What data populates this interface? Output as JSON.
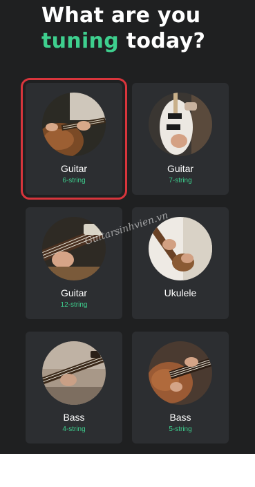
{
  "header": {
    "line1": "What are you",
    "accent": "tuning",
    "rest": "today?"
  },
  "instruments": [
    {
      "name": "Guitar",
      "sub": "6-string",
      "icon": "acoustic-guitar-photo",
      "selected": true
    },
    {
      "name": "Guitar",
      "sub": "7-string",
      "icon": "electric-guitar-photo"
    },
    {
      "name": "Guitar",
      "sub": "12-string",
      "icon": "twelve-string-guitar-photo"
    },
    {
      "name": "Ukulele",
      "sub": "",
      "icon": "ukulele-photo"
    },
    {
      "name": "Bass",
      "sub": "4-string",
      "icon": "bass-4-photo"
    },
    {
      "name": "Bass",
      "sub": "5-string",
      "icon": "bass-5-photo"
    }
  ],
  "watermark": "Guitarsinhvien.vn",
  "colors": {
    "background": "#1f2021",
    "card": "#2c2e31",
    "accent": "#3ecf8e",
    "selection": "#d8353c"
  }
}
